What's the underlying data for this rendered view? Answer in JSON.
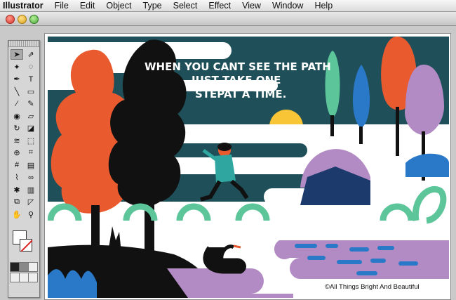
{
  "menubar": {
    "app_name": "Illustrator",
    "items": [
      "File",
      "Edit",
      "Object",
      "Type",
      "Select",
      "Effect",
      "View",
      "Window",
      "Help"
    ]
  },
  "artwork": {
    "quote_line1": "WHEN YOU CANT SEE THE PATH",
    "quote_line2": "JUST TAKE ONE",
    "quote_line3": "STEPAT A TIME.",
    "copyright": "©All Things Bright And Beautiful"
  },
  "colors": {
    "sky": "#1f5059",
    "cloud": "#ffffff",
    "orange": "#ea5a2f",
    "black": "#111111",
    "green": "#5cc59a",
    "blue": "#2a78c8",
    "purple": "#b28bc4",
    "yellow": "#f7c536"
  },
  "toolbox": {
    "tools": [
      "selection-tool",
      "direct-selection-tool",
      "magic-wand-tool",
      "lasso-tool",
      "pen-tool",
      "type-tool",
      "line-tool",
      "rectangle-tool",
      "paintbrush-tool",
      "pencil-tool",
      "blob-brush-tool",
      "eraser-tool",
      "rotate-tool",
      "scale-tool",
      "warp-tool",
      "free-transform-tool",
      "shape-builder-tool",
      "perspective-grid-tool",
      "mesh-tool",
      "gradient-tool",
      "eyedropper-tool",
      "blend-tool",
      "symbol-sprayer-tool",
      "column-graph-tool",
      "artboard-tool",
      "slice-tool",
      "hand-tool",
      "zoom-tool"
    ]
  }
}
